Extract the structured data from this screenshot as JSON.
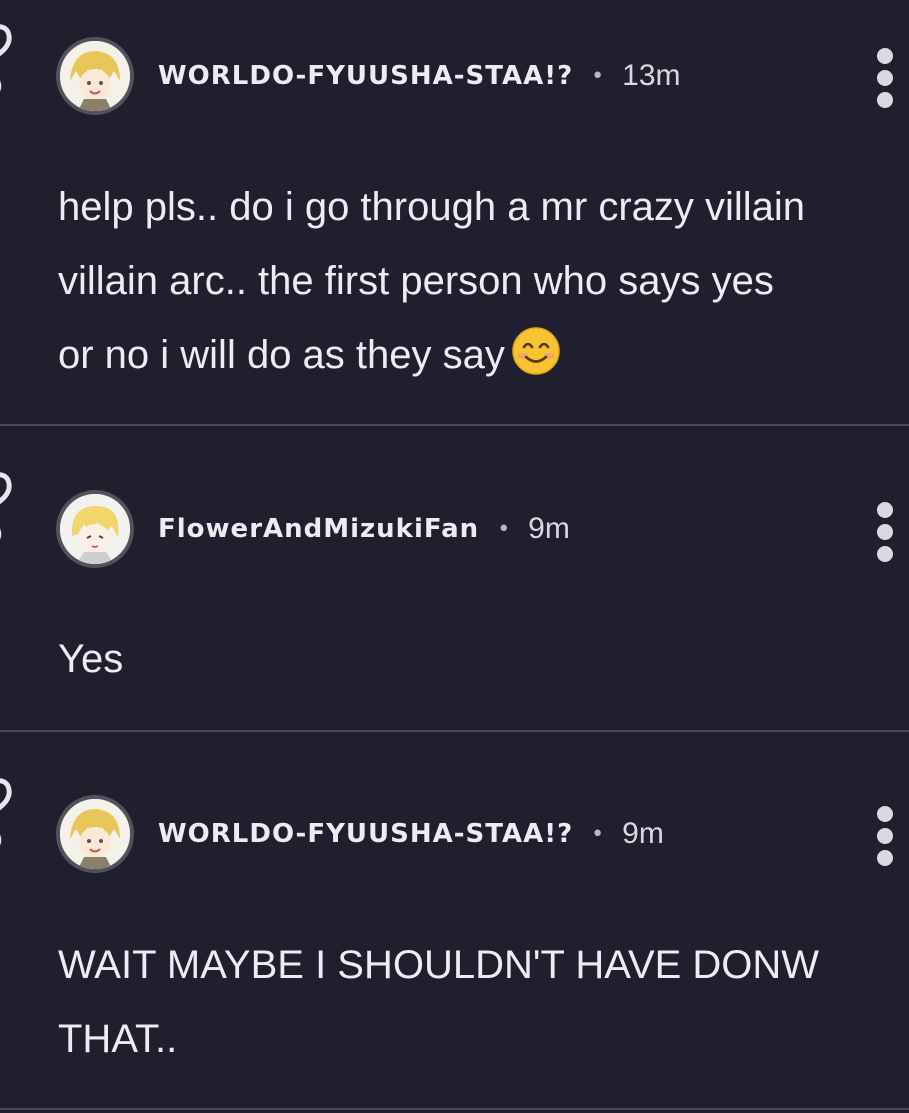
{
  "posts": [
    {
      "author": "WORLDO-FYUUSHA-STAA!?",
      "separator": "•",
      "time": "13m",
      "body": "help pls.. do i go through a mr crazy villain\nvillain arc.. the first person who says yes\nor no i will do as they say",
      "body_emoji": "smiling-face-emoji"
    },
    {
      "author": "FlowerAndMizukiFan",
      "separator": "•",
      "time": "9m",
      "body": "Yes"
    },
    {
      "author": "WORLDO-FYUUSHA-STAA!?",
      "separator": "•",
      "time": "9m",
      "body": "WAIT MAYBE I SHOULDN'T HAVE DONW\nTHAT.."
    }
  ],
  "icons": {
    "menu": "more-vertical-icon",
    "vote": "vote-arrow-icon"
  },
  "colors": {
    "background": "#201f2e",
    "text": "#ececf2",
    "divider": "#4a4a5a",
    "avatar_ring": "#52525c"
  }
}
